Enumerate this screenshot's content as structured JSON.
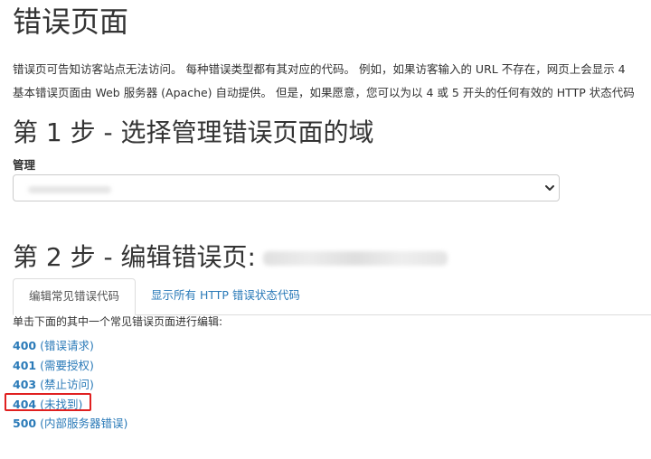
{
  "page": {
    "title": "错误页面",
    "description_line1": "错误页可告知访客站点无法访问。 每种错误类型都有其对应的代码。 例如，如果访客输入的 URL 不存在，网页上会显示 4",
    "description_line2": "基本错误页面由 Web 服务器 (Apache) 自动提供。 但是，如果愿意，您可以为以 4 或 5 开头的任何有效的 HTTP 状态代码"
  },
  "step1": {
    "heading": "第 1 步 - 选择管理错误页面的域",
    "field_label": "管理",
    "select_value": ""
  },
  "step2": {
    "heading": "第 2 步 - 编辑错误页:",
    "domain_value": ""
  },
  "tabs": [
    {
      "label": "编辑常见错误代码",
      "active": true
    },
    {
      "label": "显示所有 HTTP 错误状态代码",
      "active": false
    }
  ],
  "instruction": "单击下面的其中一个常见错误页面进行编辑:",
  "error_codes": [
    {
      "code": "400",
      "label": "(错误请求)"
    },
    {
      "code": "401",
      "label": "(需要授权)"
    },
    {
      "code": "403",
      "label": "(禁止访问)"
    },
    {
      "code": "404",
      "label": "(未找到)",
      "highlighted": true
    },
    {
      "code": "500",
      "label": "(内部服务器错误)"
    }
  ],
  "colors": {
    "link": "#2a7ab8",
    "text": "#333333",
    "highlight_border": "#e02020",
    "border": "#dddddd"
  },
  "icons": {
    "select_arrow": "chevron-down-icon"
  }
}
